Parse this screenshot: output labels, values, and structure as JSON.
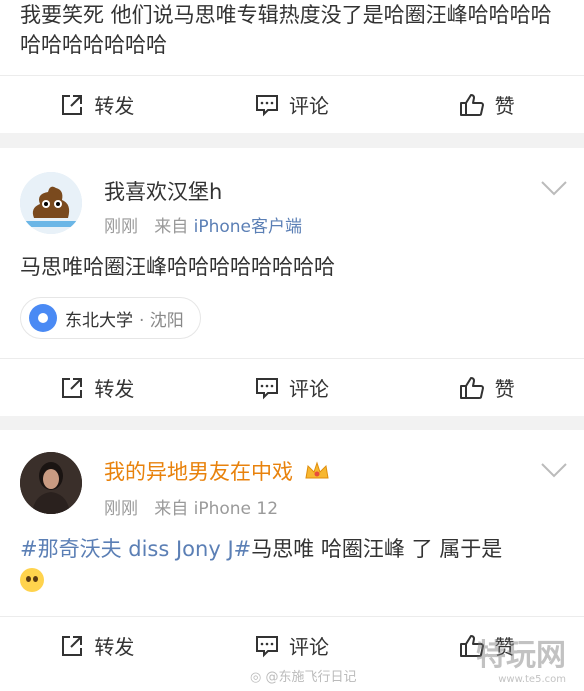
{
  "posts": [
    {
      "text": "我要笑死 他们说马思唯专辑热度没了是哈圈汪峰哈哈哈哈哈哈哈哈哈哈哈",
      "actions": {
        "repost": "转发",
        "comment": "评论",
        "like": "赞"
      }
    },
    {
      "username": "我喜欢汉堡h",
      "time": "刚刚",
      "from_label": "来自",
      "source": "iPhone客户端",
      "text": "马思唯哈圈汪峰哈哈哈哈哈哈哈哈",
      "location": {
        "name": "东北大学",
        "city": "· 沈阳"
      },
      "actions": {
        "repost": "转发",
        "comment": "评论",
        "like": "赞"
      }
    },
    {
      "username": "我的异地男友在中戏",
      "time": "刚刚",
      "from_label": "来自",
      "source": "iPhone 12",
      "hashtag": "#那奇沃夫 diss Jony J#",
      "text": "马思唯 哈圈汪峰 了 属于是",
      "emoji": "sad-face-emoji",
      "actions": {
        "repost": "转发",
        "comment": "评论",
        "like": "赞"
      }
    }
  ],
  "watermarks": {
    "weibo": "@东施飞行日记",
    "site": "特玩网",
    "site_url": "www.te5.com"
  },
  "colors": {
    "link": "#5b7fb5",
    "vip_name": "#e8820c",
    "meta": "#9a9a9a"
  }
}
